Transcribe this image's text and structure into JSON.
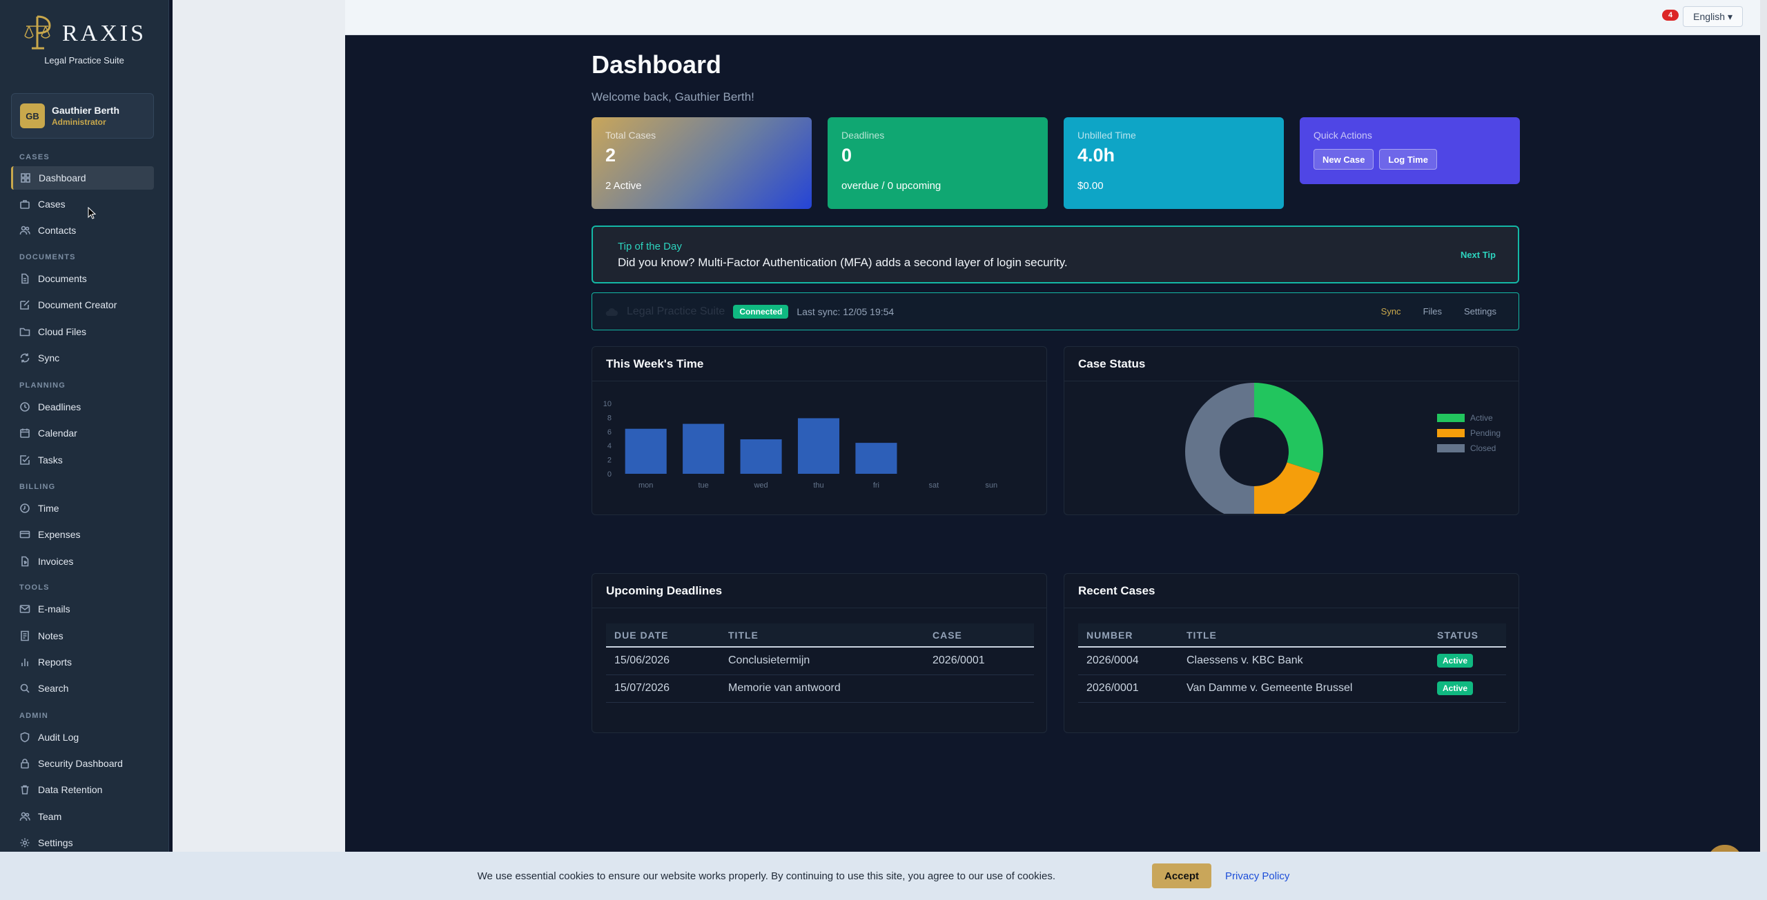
{
  "brand": {
    "logo_text": "RAXIS",
    "subtitle": "Legal Practice Suite"
  },
  "user": {
    "initials": "GB",
    "name": "Gauthier Berth",
    "role": "Administrator"
  },
  "nav": {
    "sections": {
      "cases": "CASES",
      "documents": "DOCUMENTS",
      "planning": "PLANNING",
      "billing": "BILLING",
      "tools": "TOOLS",
      "admin": "ADMIN"
    },
    "items": {
      "dashboard": "Dashboard",
      "cases": "Cases",
      "contacts": "Contacts",
      "documents": "Documents",
      "document_creator": "Document Creator",
      "cloud_files": "Cloud Files",
      "sync": "Sync",
      "deadlines": "Deadlines",
      "calendar": "Calendar",
      "tasks": "Tasks",
      "time": "Time",
      "expenses": "Expenses",
      "invoices": "Invoices",
      "emails": "E-mails",
      "notes": "Notes",
      "reports": "Reports",
      "search": "Search",
      "audit_log": "Audit Log",
      "security_dashboard": "Security Dashboard",
      "data_retention": "Data Retention",
      "team": "Team",
      "settings": "Settings"
    }
  },
  "topbar": {
    "notifications": "4",
    "language": "English ▾"
  },
  "page": {
    "title": "Dashboard",
    "welcome": "Welcome back, Gauthier Berth!"
  },
  "stats": {
    "cases": {
      "label": "Total Cases",
      "value": "2",
      "sub": "2 Active"
    },
    "deadlines": {
      "label": "Deadlines",
      "value": "0",
      "sub": "overdue / 0 upcoming"
    },
    "unbilled": {
      "label": "Unbilled Time",
      "value": "4.0h",
      "sub": "$0.00"
    },
    "quick": {
      "label": "Quick Actions",
      "new_case": "New Case",
      "log_time": "Log Time"
    }
  },
  "tip": {
    "title": "Tip of the Day",
    "text": "Did you know? Multi-Factor Authentication (MFA) adds a second layer of login security.",
    "next": "Next Tip"
  },
  "sync": {
    "name": "Legal Practice Suite",
    "status": "Connected",
    "last_sync": "Last sync: 12/05 19:54",
    "actions": {
      "sync": "Sync",
      "files": "Files",
      "settings": "Settings"
    }
  },
  "week_panel": {
    "title": "This Week's Time"
  },
  "status_panel": {
    "title": "Case Status"
  },
  "chart_data": [
    {
      "type": "bar",
      "categories": [
        "mon",
        "tue",
        "wed",
        "thu",
        "fri",
        "sat",
        "sun"
      ],
      "values": [
        6.4,
        7.1,
        4.9,
        7.9,
        4.4,
        0,
        0
      ],
      "ylim": [
        0,
        10
      ],
      "yticks": [
        0,
        2,
        4,
        6,
        8,
        10
      ],
      "color": "#2d5fb8",
      "grid": false
    },
    {
      "type": "pie",
      "donut": true,
      "categories": [
        "Active",
        "Pending",
        "Closed"
      ],
      "values": [
        30,
        20,
        50
      ],
      "colors": [
        "#22c55e",
        "#f59e0b",
        "#64748b"
      ],
      "legend": "right"
    }
  ],
  "deadlines_table": {
    "title": "Upcoming Deadlines",
    "headers": [
      "DUE DATE",
      "TITLE",
      "CASE"
    ],
    "rows": [
      [
        "15/06/2026",
        "Conclusietermijn",
        "2026/0001"
      ],
      [
        "15/07/2026",
        "Memorie van antwoord",
        ""
      ]
    ]
  },
  "recent_table": {
    "title": "Recent Cases",
    "headers": [
      "NUMBER",
      "TITLE",
      "STATUS"
    ],
    "rows": [
      [
        "2026/0004",
        "Claessens v. KBC Bank",
        "Active"
      ],
      [
        "2026/0001",
        "Van Damme v. Gemeente Brussel",
        "Active"
      ]
    ]
  },
  "cookie": {
    "text": "We use essential cookies to ensure our website works properly. By continuing to use this site, you agree to our use of cookies.",
    "accept": "Accept",
    "policy": "Privacy Policy"
  }
}
